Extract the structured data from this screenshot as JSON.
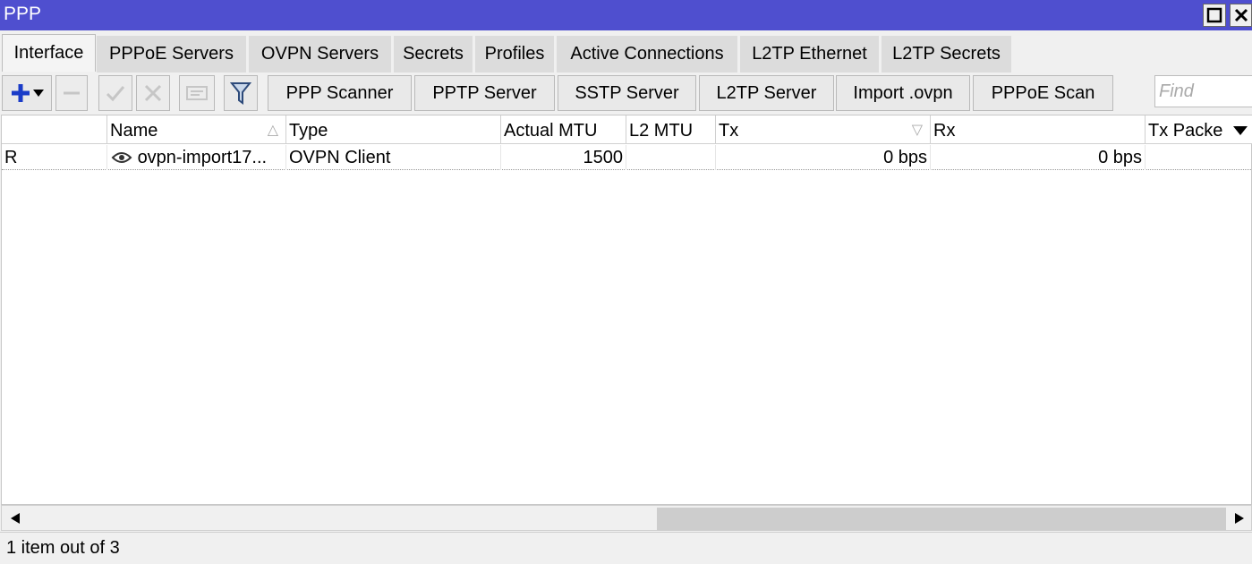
{
  "window": {
    "title": "PPP"
  },
  "tabs": [
    {
      "label": "Interface"
    },
    {
      "label": "PPPoE Servers"
    },
    {
      "label": "OVPN Servers"
    },
    {
      "label": "Secrets"
    },
    {
      "label": "Profiles"
    },
    {
      "label": "Active Connections"
    },
    {
      "label": "L2TP Ethernet"
    },
    {
      "label": "L2TP Secrets"
    }
  ],
  "toolbar": {
    "buttons": [
      {
        "label": "PPP Scanner"
      },
      {
        "label": "PPTP Server"
      },
      {
        "label": "SSTP Server"
      },
      {
        "label": "L2TP Server"
      },
      {
        "label": "Import .ovpn"
      },
      {
        "label": "PPPoE Scan"
      }
    ],
    "find_placeholder": "Find"
  },
  "table": {
    "columns": [
      {
        "label": ""
      },
      {
        "label": "Name"
      },
      {
        "label": "Type"
      },
      {
        "label": "Actual MTU"
      },
      {
        "label": "L2 MTU"
      },
      {
        "label": "Tx"
      },
      {
        "label": "Rx"
      },
      {
        "label": "Tx Packe"
      }
    ],
    "rows": [
      {
        "flag": "R",
        "name": "ovpn-import17...",
        "type": "OVPN Client",
        "actual_mtu": "1500",
        "l2_mtu": "",
        "tx": "0 bps",
        "rx": "0 bps",
        "tx_packets": ""
      }
    ]
  },
  "status": {
    "text": "1 item out of 3"
  },
  "colors": {
    "titlebar": "#4f4fcf",
    "accent_plus": "#1a3cc8"
  },
  "icons": [
    "add-icon",
    "dropdown-icon",
    "remove-icon",
    "check-icon",
    "cross-icon",
    "comment-icon",
    "filter-icon",
    "eye-icon",
    "sort-asc-icon",
    "sort-desc-icon",
    "column-menu-icon",
    "scroll-left-icon",
    "scroll-right-icon",
    "maximize-icon",
    "close-icon"
  ]
}
